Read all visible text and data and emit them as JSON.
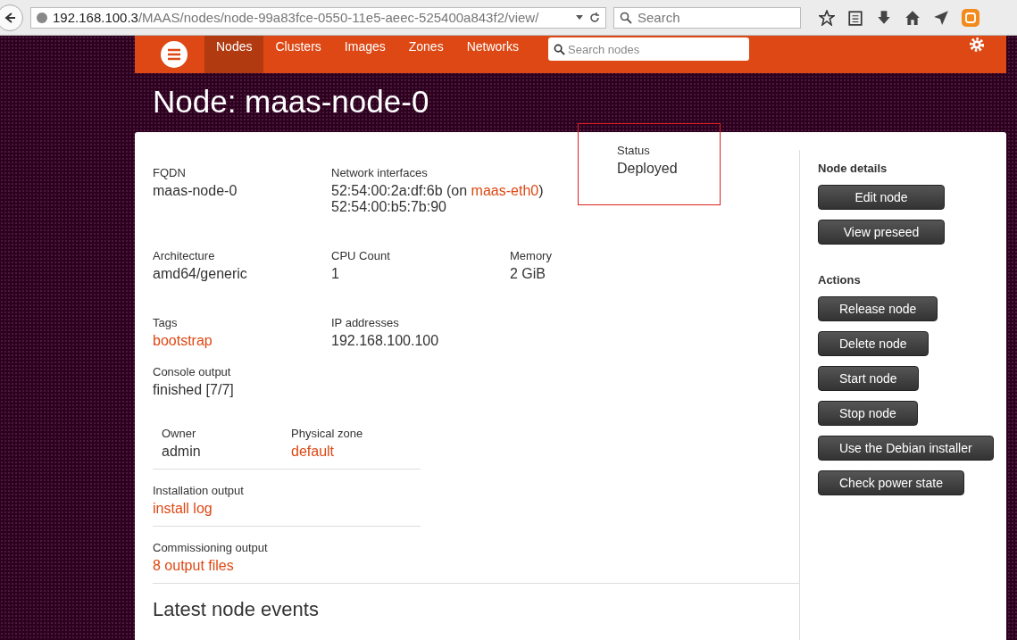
{
  "browser": {
    "url_host": "192.168.100.3",
    "url_path": "/MAAS/nodes/node-99a83fce-0550-11e5-aeec-525400a843f2/view/",
    "search_placeholder": "Search"
  },
  "nav": {
    "tabs": [
      {
        "label": "Nodes",
        "selected": true
      },
      {
        "label": "Clusters",
        "selected": false
      },
      {
        "label": "Images",
        "selected": false
      },
      {
        "label": "Zones",
        "selected": false
      },
      {
        "label": "Networks",
        "selected": false
      }
    ],
    "search_placeholder": "Search nodes"
  },
  "title": "Node: maas-node-0",
  "rows": [
    {
      "fields": [
        {
          "label": "FQDN",
          "highlighted": false,
          "lines": [
            [
              {
                "text": "maas-node-0",
                "link": false
              }
            ]
          ]
        },
        {
          "label": "Network interfaces",
          "highlighted": false,
          "lines": [
            [
              {
                "text": "52:54:00:2a:df:6b (on ",
                "link": false
              },
              {
                "text": "maas-eth0",
                "link": true
              },
              {
                "text": ")",
                "link": false
              }
            ],
            [
              {
                "text": "52:54:00:b5:7b:90",
                "link": false
              }
            ]
          ]
        },
        {
          "label": "Status",
          "highlighted": true,
          "lines": [
            [
              {
                "text": "Deployed",
                "link": false
              }
            ]
          ]
        }
      ]
    },
    {
      "fields": [
        {
          "label": "Architecture",
          "highlighted": false,
          "lines": [
            [
              {
                "text": "amd64/generic",
                "link": false
              }
            ]
          ]
        },
        {
          "label": "CPU Count",
          "highlighted": false,
          "lines": [
            [
              {
                "text": "1",
                "link": false
              }
            ]
          ]
        },
        {
          "label": "Memory",
          "highlighted": false,
          "lines": [
            [
              {
                "text": "2 GiB",
                "link": false
              }
            ]
          ]
        }
      ]
    },
    {
      "fields": [
        {
          "label": "Tags",
          "highlighted": false,
          "lines": [
            [
              {
                "text": "bootstrap",
                "link": true
              }
            ]
          ]
        },
        {
          "label": "IP addresses",
          "highlighted": false,
          "lines": [
            [
              {
                "text": "192.168.100.100",
                "link": false
              }
            ]
          ]
        }
      ]
    },
    {
      "fields": [
        {
          "label": "Console output",
          "highlighted": false,
          "lines": [
            [
              {
                "text": "finished [7/7]",
                "link": false
              }
            ]
          ]
        }
      ]
    }
  ],
  "ownership": [
    {
      "label": "Owner",
      "value": "admin",
      "link": false
    },
    {
      "label": "Physical zone",
      "value": "default",
      "link": true
    }
  ],
  "outputs": [
    {
      "label": "Installation output",
      "value": "install log"
    },
    {
      "label": "Commissioning output",
      "value": "8 output files"
    }
  ],
  "events_heading": "Latest node events",
  "sidebar": [
    {
      "kind": "details",
      "heading": "Node details",
      "buttons": [
        "Edit node",
        "View preseed"
      ]
    },
    {
      "kind": "actions",
      "heading": "Actions",
      "buttons": [
        "Release node",
        "Delete node",
        "Start node",
        "Stop node",
        "Use the Debian installer",
        "Check power state"
      ]
    }
  ]
}
